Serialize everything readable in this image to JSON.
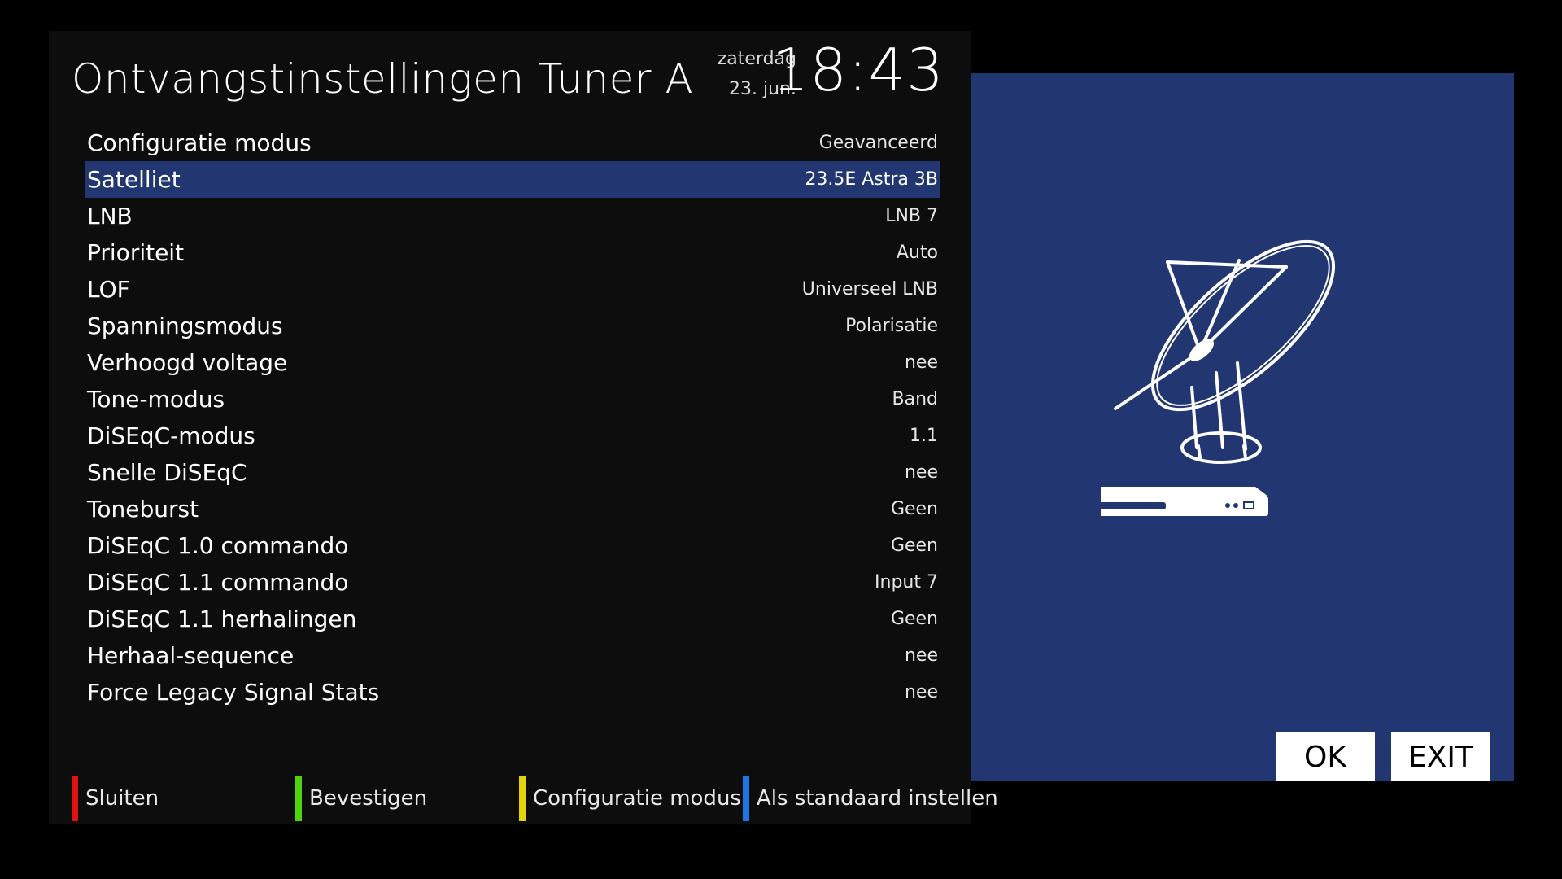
{
  "header": {
    "title": "Ontvangstinstellingen Tuner A",
    "day": "zaterdag",
    "date": "23. jun.",
    "time": "18:43"
  },
  "settings": [
    {
      "label": "Configuratie modus",
      "value": "Geavanceerd"
    },
    {
      "label": "Satelliet",
      "value": "23.5E Astra 3B",
      "selected": true
    },
    {
      "label": "LNB",
      "value": "LNB 7"
    },
    {
      "label": "Prioriteit",
      "value": "Auto"
    },
    {
      "label": "LOF",
      "value": "Universeel LNB"
    },
    {
      "label": "Spanningsmodus",
      "value": "Polarisatie"
    },
    {
      "label": "Verhoogd voltage",
      "value": "nee"
    },
    {
      "label": "Tone-modus",
      "value": "Band"
    },
    {
      "label": "DiSEqC-modus",
      "value": "1.1"
    },
    {
      "label": "Snelle DiSEqC",
      "value": "nee"
    },
    {
      "label": "Toneburst",
      "value": "Geen"
    },
    {
      "label": "DiSEqC 1.0 commando",
      "value": "Geen"
    },
    {
      "label": "DiSEqC 1.1 commando",
      "value": "Input 7"
    },
    {
      "label": "DiSEqC 1.1 herhalingen",
      "value": "Geen"
    },
    {
      "label": "Herhaal-sequence",
      "value": "nee"
    },
    {
      "label": "Force Legacy Signal Stats",
      "value": "nee"
    }
  ],
  "footer": [
    {
      "label": "Sluiten",
      "color": "#e0140f"
    },
    {
      "label": "Bevestigen",
      "color": "#4fd20f"
    },
    {
      "label": "Configuratie modus",
      "color": "#e3d40a"
    },
    {
      "label": "Als standaard instellen",
      "color": "#1c77e0"
    }
  ],
  "side": {
    "ok_label": "OK",
    "exit_label": "EXIT",
    "illustration_icon": "satellite-dish-receiver-icon",
    "background": "#223671"
  }
}
